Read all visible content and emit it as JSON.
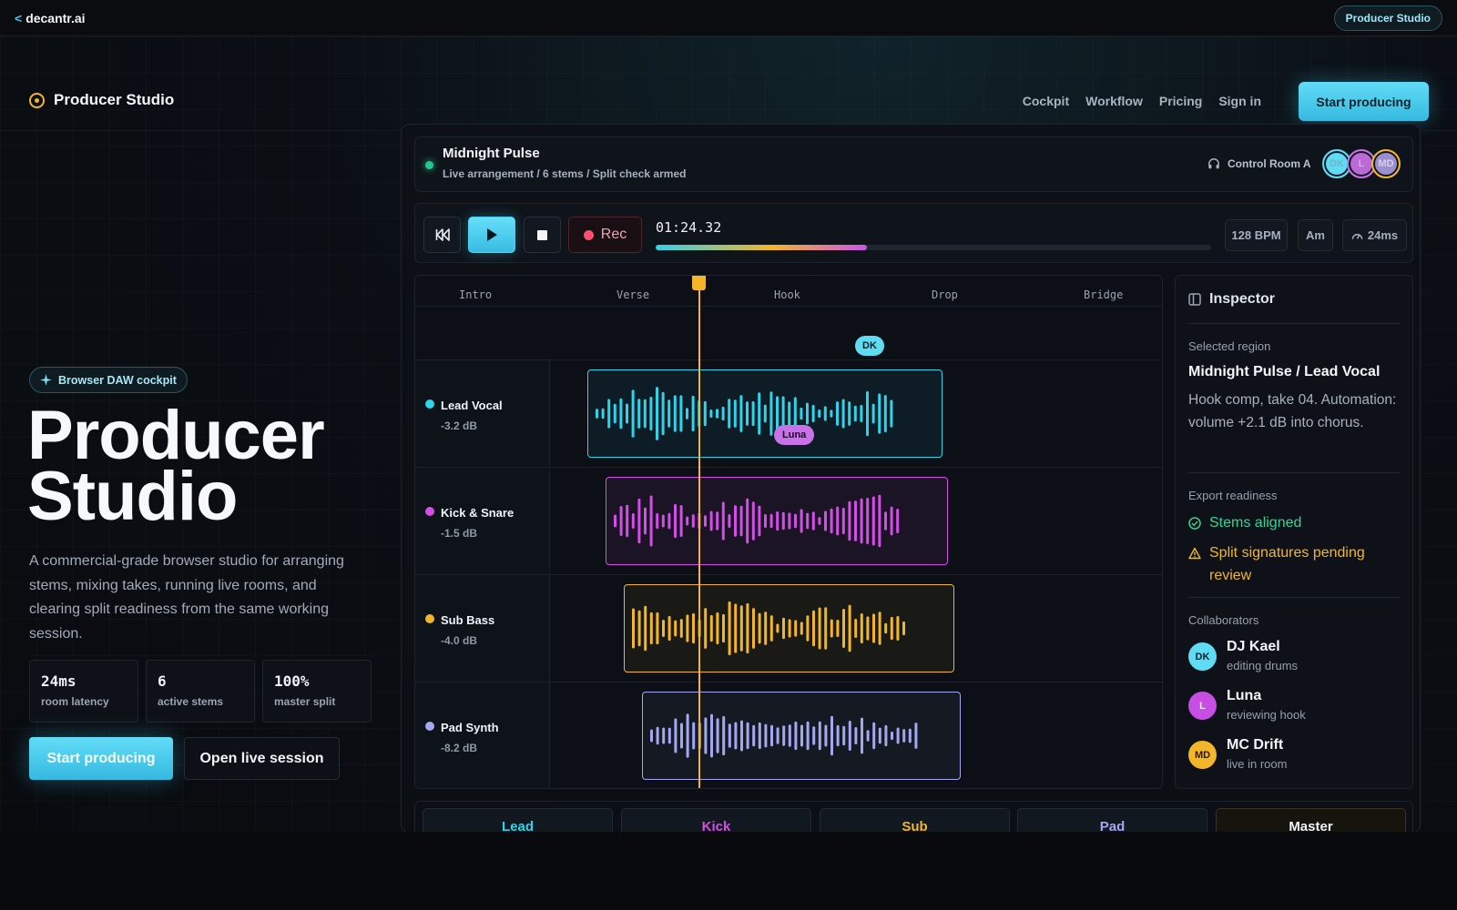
{
  "topbar": {
    "back_label": "decantr.ai",
    "brand_pill": "Producer Studio"
  },
  "nav": {
    "logo": "Producer Studio",
    "links": [
      "Cockpit",
      "Workflow",
      "Pricing",
      "Sign in"
    ],
    "cta": "Start producing"
  },
  "hero": {
    "badge": "Browser DAW cockpit",
    "title_line1": "Producer",
    "title_line2": "Studio",
    "description": "A commercial-grade browser studio for arranging stems, mixing takes, running live rooms, and clearing split readiness from the same working session.",
    "stats": [
      {
        "value": "24ms",
        "label": "room latency"
      },
      {
        "value": "6",
        "label": "active stems"
      },
      {
        "value": "100%",
        "label": "master split"
      }
    ],
    "primary_cta": "Start producing",
    "secondary_cta": "Open live session"
  },
  "session": {
    "title": "Midnight Pulse",
    "subtitle": "Live arrangement / 6 stems / Split check armed",
    "room": "Control Room A",
    "avatars": [
      {
        "initials": "DK",
        "color": "#5fdcf4"
      },
      {
        "initials": "L",
        "color": "#c872e8"
      },
      {
        "initials": "MD",
        "color": "#f3b52a"
      }
    ]
  },
  "transport": {
    "rec_label": "Rec",
    "timecode": "01:24.32",
    "progress": 0.38,
    "bpm": "128 BPM",
    "key": "Am",
    "latency": "24ms"
  },
  "arrangement": {
    "sections": [
      "Intro",
      "Verse",
      "Hook",
      "Drop",
      "Bridge"
    ],
    "tracks": [
      {
        "name": "Lead Vocal",
        "db": "-3.2 dB",
        "color": "#2fd3ea"
      },
      {
        "name": "Kick & Snare",
        "db": "-1.5 dB",
        "color": "#d24fe6"
      },
      {
        "name": "Sub Bass",
        "db": "-4.0 dB",
        "color": "#f3b52a"
      },
      {
        "name": "Pad Synth",
        "db": "-8.2 dB",
        "color": "#a4a8f0"
      }
    ],
    "collab_tags": {
      "dk": "DK",
      "luna": "Luna"
    }
  },
  "inspector": {
    "title": "Inspector",
    "selected_label": "Selected region",
    "selected_title": "Midnight Pulse / Lead Vocal",
    "selected_desc": "Hook comp, take 04. Automation: volume +2.1 dB into chorus.",
    "export_label": "Export readiness",
    "export_ok": "Stems aligned",
    "export_warn": "Split signatures pending review",
    "collab_label": "Collaborators",
    "collaborators": [
      {
        "initials": "DK",
        "name": "DJ Kael",
        "role": "editing drums",
        "color": "#5fdcf4"
      },
      {
        "initials": "L",
        "name": "Luna",
        "role": "reviewing hook",
        "color": "#c64ee3"
      },
      {
        "initials": "MD",
        "name": "MC Drift",
        "role": "live in room",
        "color": "#f3b52a"
      }
    ]
  },
  "mixer": {
    "channels": [
      {
        "label": "Lead",
        "color": "#2fd3ea"
      },
      {
        "label": "Kick",
        "color": "#d24fe6"
      },
      {
        "label": "Sub",
        "color": "#f3b52a"
      },
      {
        "label": "Pad",
        "color": "#a4a8f0"
      },
      {
        "label": "Master",
        "color": "#f1f3f6"
      }
    ]
  }
}
